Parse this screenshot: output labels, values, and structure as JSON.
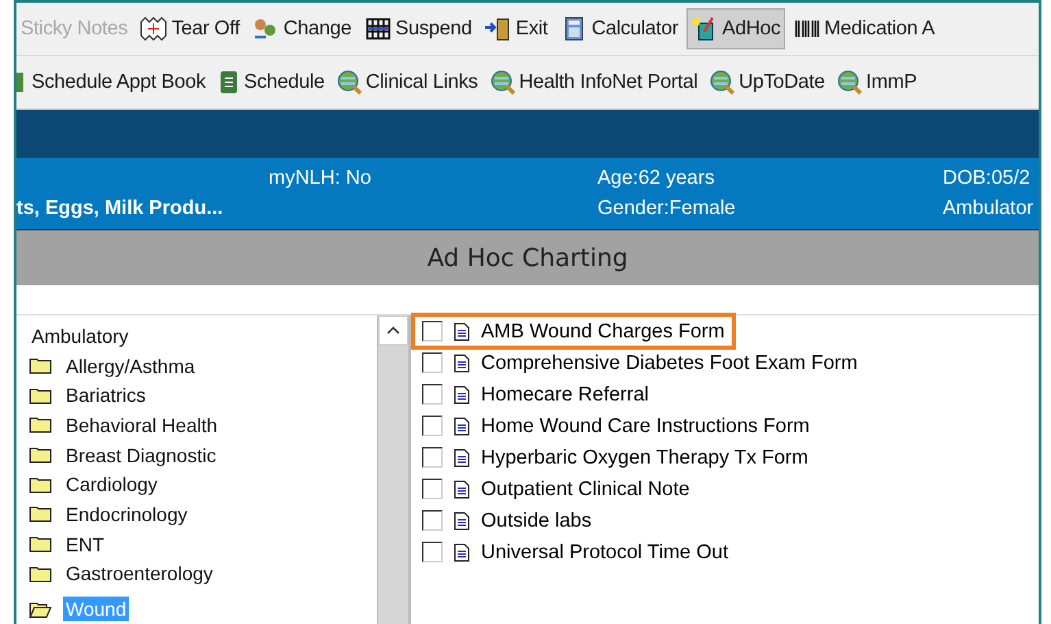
{
  "toolbar_1": [
    {
      "label": "Sticky Notes",
      "disabled": true,
      "selected": false
    },
    {
      "label": "Tear Off",
      "disabled": false,
      "selected": false
    },
    {
      "label": "Change",
      "disabled": false,
      "selected": false
    },
    {
      "label": "Suspend",
      "disabled": false,
      "selected": false
    },
    {
      "label": "Exit",
      "disabled": false,
      "selected": false
    },
    {
      "label": "Calculator",
      "disabled": false,
      "selected": false
    },
    {
      "label": "AdHoc",
      "disabled": false,
      "selected": true
    },
    {
      "label": "Medication A",
      "disabled": false,
      "selected": false
    }
  ],
  "toolbar_2": [
    {
      "label": "Schedule Appt Book"
    },
    {
      "label": "Schedule"
    },
    {
      "label": "Clinical Links"
    },
    {
      "label": "Health InfoNet Portal"
    },
    {
      "label": "UpToDate"
    },
    {
      "label": "ImmP"
    }
  ],
  "banner": {
    "allergies": "ts, Eggs, Milk Produ...",
    "portal": "myNLH: No",
    "age": "Age:62 years",
    "gender": "Gender:Female",
    "dob": "DOB:05/2",
    "location": "Ambulator"
  },
  "title": "Ad Hoc Charting",
  "tree": [
    {
      "label": "Ambulatory",
      "children": [
        {
          "label": "Allergy/Asthma",
          "expanded": false,
          "selected": false
        },
        {
          "label": "Bariatrics",
          "expanded": false,
          "selected": false
        },
        {
          "label": "Behavioral Health",
          "expanded": false,
          "selected": false
        },
        {
          "label": "Breast Diagnostic",
          "expanded": false,
          "selected": false
        },
        {
          "label": "Cardiology",
          "expanded": false,
          "selected": false
        },
        {
          "label": "Endocrinology",
          "expanded": false,
          "selected": false
        },
        {
          "label": "ENT",
          "expanded": false,
          "selected": false
        },
        {
          "label": "Gastroenterology",
          "expanded": false,
          "selected": false
        },
        {
          "label": "Wound",
          "expanded": true,
          "selected": true
        }
      ]
    }
  ],
  "forms": [
    {
      "label": "AMB Wound Charges Form",
      "checked": false,
      "highlighted": true
    },
    {
      "label": "Comprehensive Diabetes Foot Exam Form",
      "checked": false,
      "highlighted": false
    },
    {
      "label": "Homecare Referral",
      "checked": false,
      "highlighted": false
    },
    {
      "label": "Home Wound Care Instructions Form",
      "checked": false,
      "highlighted": false
    },
    {
      "label": "Hyperbaric Oxygen Therapy Tx Form",
      "checked": false,
      "highlighted": false
    },
    {
      "label": "Outpatient Clinical Note",
      "checked": false,
      "highlighted": false
    },
    {
      "label": "Outside labs",
      "checked": false,
      "highlighted": false
    },
    {
      "label": "Universal Protocol Time Out",
      "checked": false,
      "highlighted": false
    }
  ]
}
